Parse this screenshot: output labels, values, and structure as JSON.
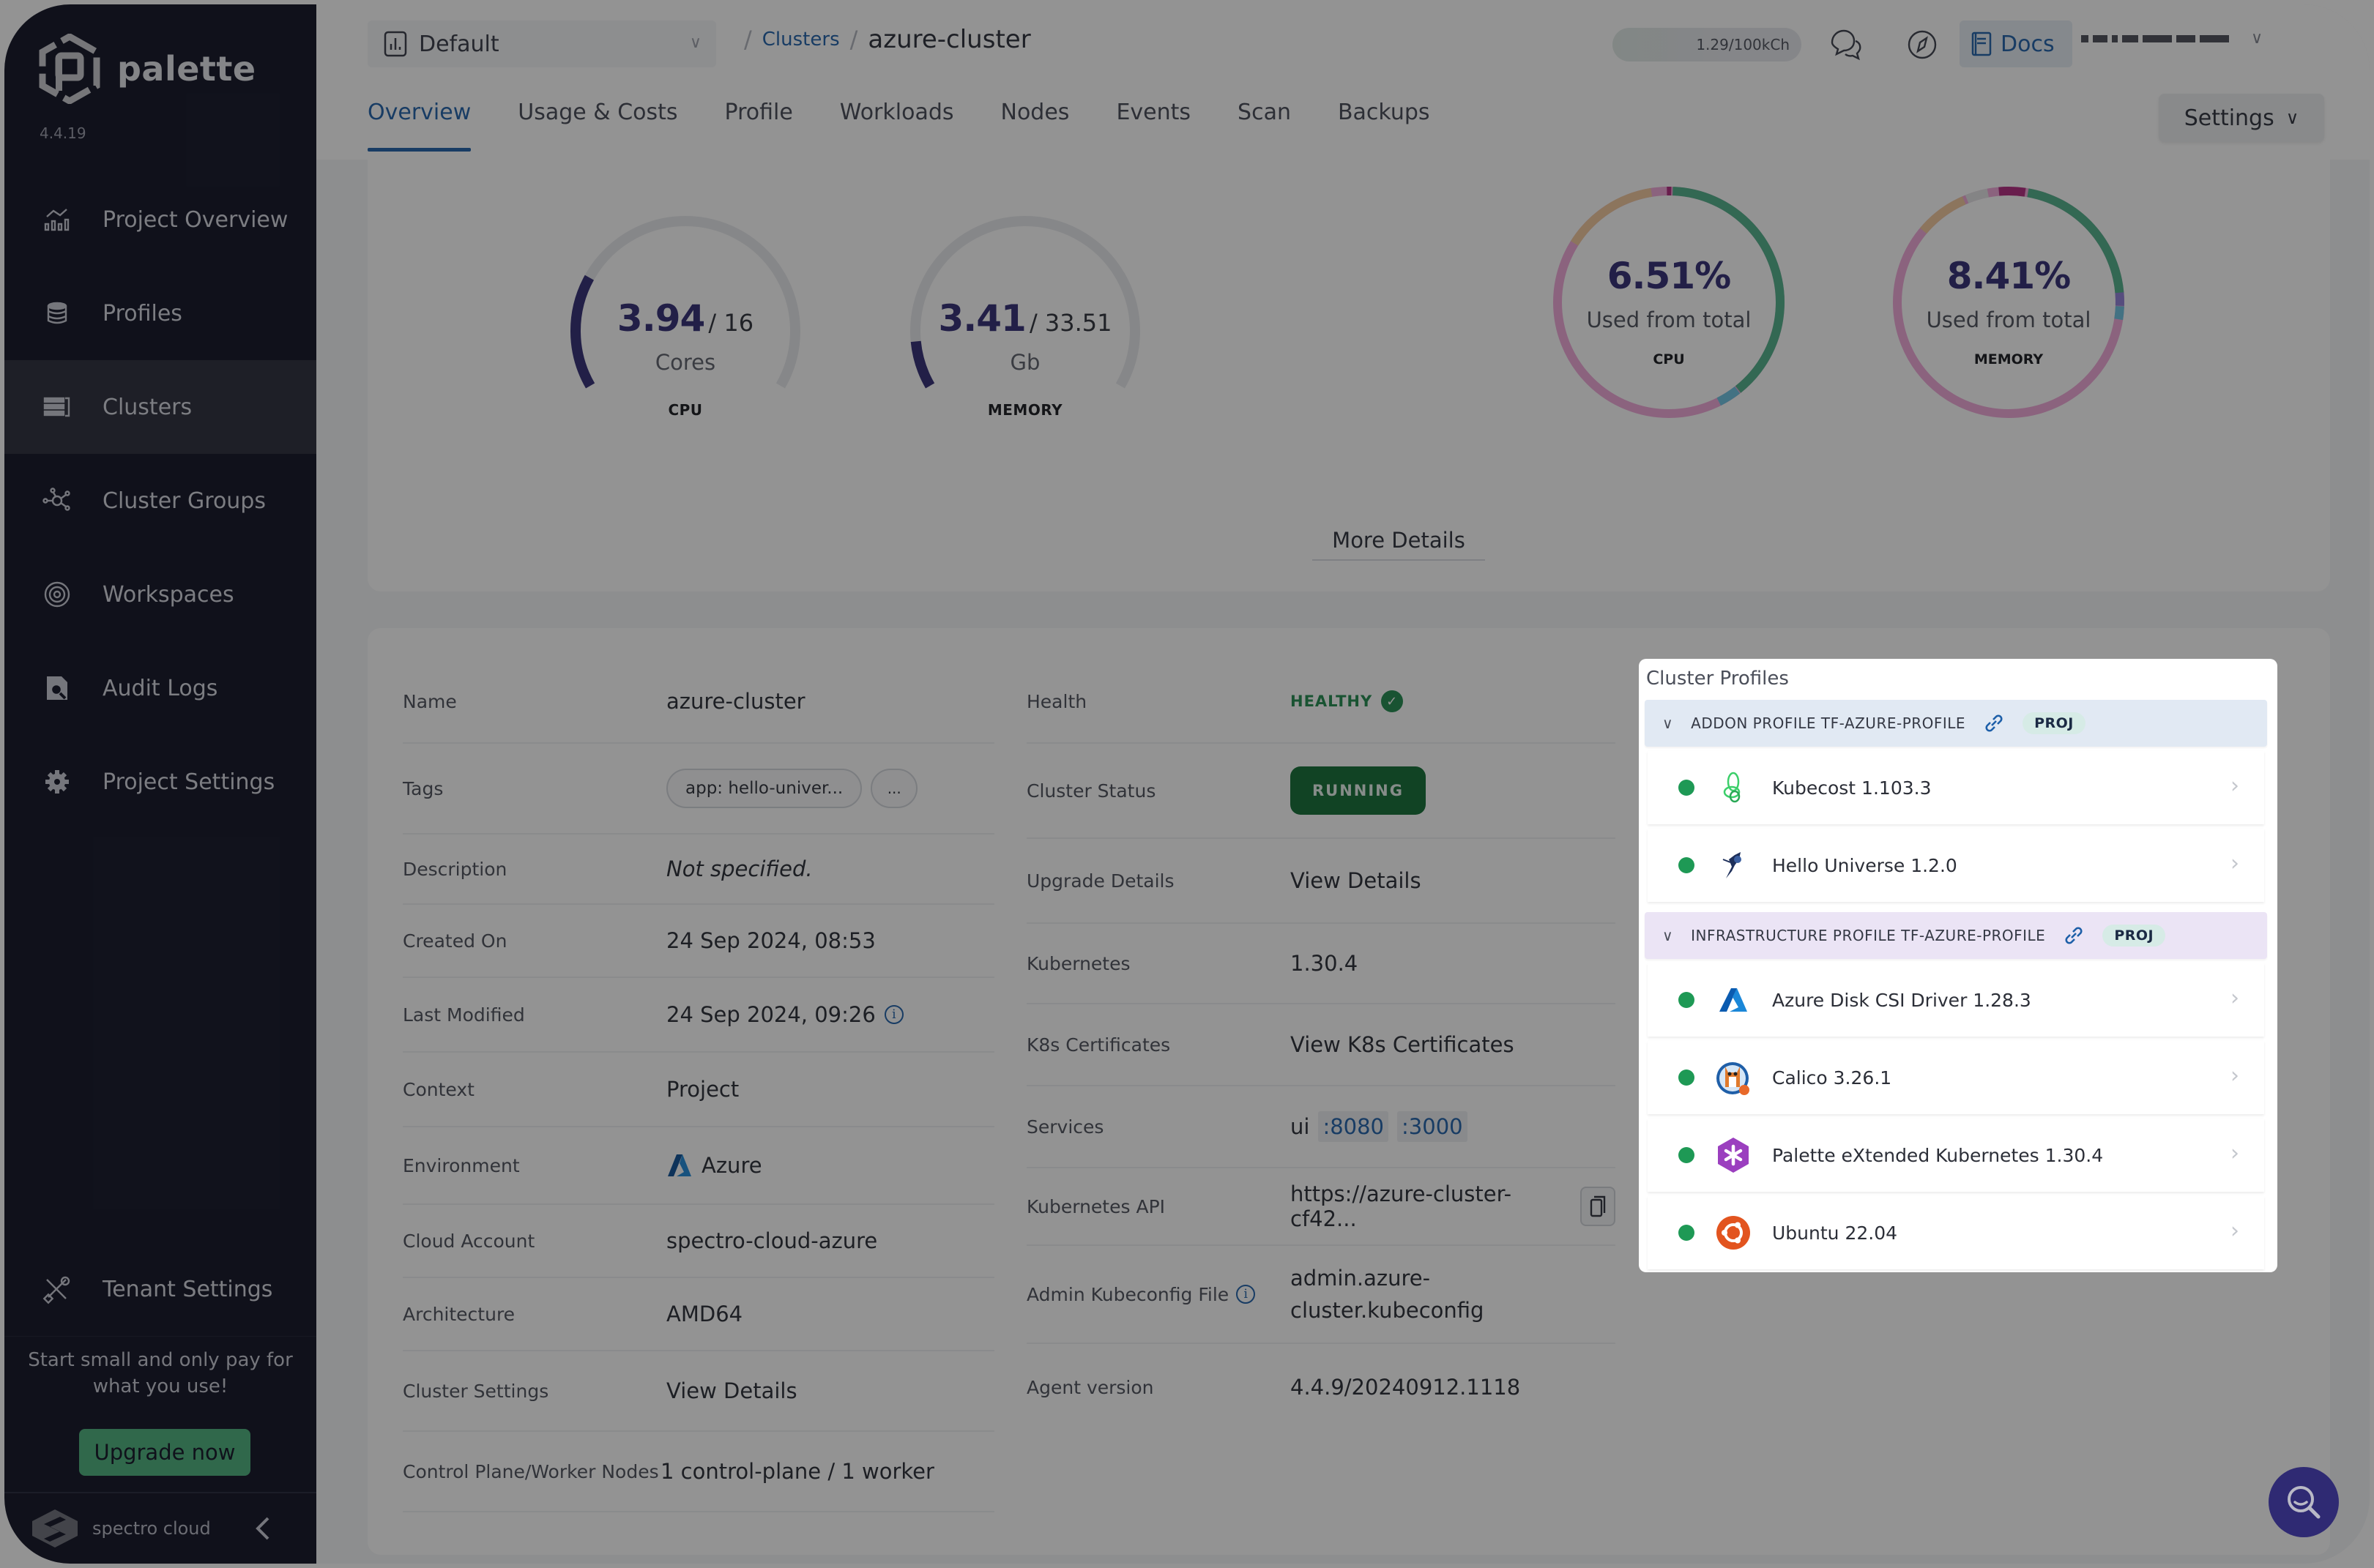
{
  "app": {
    "product_name": "palette",
    "version": "4.4.19"
  },
  "sidebar": {
    "items": [
      {
        "label": "Project Overview",
        "icon": "chart-line-bars-icon",
        "active": false
      },
      {
        "label": "Profiles",
        "icon": "database-stack-icon",
        "active": false
      },
      {
        "label": "Clusters",
        "icon": "server-rack-icon",
        "active": true
      },
      {
        "label": "Cluster Groups",
        "icon": "network-nodes-icon",
        "active": false
      },
      {
        "label": "Workspaces",
        "icon": "orbit-target-icon",
        "active": false
      },
      {
        "label": "Audit Logs",
        "icon": "document-search-icon",
        "active": false
      },
      {
        "label": "Project Settings",
        "icon": "gear-icon",
        "active": false
      }
    ],
    "tenant_settings": {
      "label": "Tenant Settings",
      "icon": "tools-icon"
    },
    "promo_text": "Start small and only pay for what you use!",
    "upgrade_label": "Upgrade now",
    "footer_brand": "spectro cloud"
  },
  "header": {
    "project": "Default",
    "breadcrumb": {
      "parent": "Clusters",
      "current": "azure-cluster"
    },
    "usage": "1.29/100kCh",
    "docs_label": "Docs",
    "user_name": "[redacted]",
    "tabs": [
      {
        "label": "Overview",
        "active": true
      },
      {
        "label": "Usage & Costs",
        "active": false
      },
      {
        "label": "Profile",
        "active": false
      },
      {
        "label": "Workloads",
        "active": false
      },
      {
        "label": "Nodes",
        "active": false
      },
      {
        "label": "Events",
        "active": false
      },
      {
        "label": "Scan",
        "active": false
      },
      {
        "label": "Backups",
        "active": false
      }
    ],
    "settings_label": "Settings"
  },
  "metrics": {
    "cpu_gauge": {
      "used": "3.94",
      "total": "/ 16",
      "unit": "Cores",
      "label": "CPU",
      "fraction": 0.246
    },
    "memory_gauge": {
      "used": "3.41",
      "total": "/ 33.51",
      "unit": "Gb",
      "label": "MEMORY",
      "fraction": 0.102
    },
    "cpu_donut": {
      "percent": "6.51%",
      "subtitle": "Used from total",
      "label": "CPU"
    },
    "memory_donut": {
      "percent": "8.41%",
      "subtitle": "Used from total",
      "label": "MEMORY"
    },
    "more_details_label": "More Details",
    "colors": {
      "accent": "#2f2a73",
      "track": "#e8e9ec"
    }
  },
  "details": {
    "left": [
      {
        "label": "Name",
        "value": "azure-cluster"
      },
      {
        "label": "Tags",
        "tag": "app: hello-univer...",
        "more": "..."
      },
      {
        "label": "Description",
        "value": "Not specified."
      },
      {
        "label": "Created On",
        "value": "24 Sep 2024, 08:53"
      },
      {
        "label": "Last Modified",
        "value": "24 Sep 2024, 09:26"
      },
      {
        "label": "Context",
        "value": "Project"
      },
      {
        "label": "Environment",
        "value": "Azure"
      },
      {
        "label": "Cloud Account",
        "value": "spectro-cloud-azure"
      },
      {
        "label": "Architecture",
        "value": "AMD64"
      },
      {
        "label": "Cluster Settings",
        "value": "View Details"
      },
      {
        "label": "Control Plane/Worker Nodes",
        "value": "1 control-plane / 1 worker"
      }
    ],
    "mid": [
      {
        "label": "Health",
        "value": "HEALTHY"
      },
      {
        "label": "Cluster Status",
        "value": "RUNNING"
      },
      {
        "label": "Upgrade Details",
        "value": "View Details"
      },
      {
        "label": "Kubernetes",
        "value": "1.30.4"
      },
      {
        "label": "K8s Certificates",
        "value": "View K8s Certificates"
      },
      {
        "label": "Services",
        "value": "ui",
        "ports": [
          ":8080",
          ":3000"
        ]
      },
      {
        "label": "Kubernetes API",
        "value": "https://azure-cluster-cf42..."
      },
      {
        "label": "Admin Kubeconfig File",
        "value_line1": "admin.azure-",
        "value_line2": "cluster.kubeconfig"
      },
      {
        "label": "Agent version",
        "value": "4.4.9/20240912.1118"
      }
    ],
    "colors": {
      "link": "#1d5fa8",
      "healthy": "#1f8a4c",
      "running_bg": "#0f6b33"
    }
  },
  "cluster_profiles": {
    "title": "Cluster Profiles",
    "groups": [
      {
        "title": "ADDON PROFILE TF-AZURE-PROFILE",
        "badge": "PROJ",
        "packs": [
          {
            "name": "Kubecost 1.103.3",
            "icon": "kubecost-icon",
            "status": "healthy"
          },
          {
            "name": "Hello Universe 1.2.0",
            "icon": "hello-universe-icon",
            "status": "healthy"
          }
        ]
      },
      {
        "title": "INFRASTRUCTURE PROFILE TF-AZURE-PROFILE",
        "badge": "PROJ",
        "packs": [
          {
            "name": "Azure Disk CSI Driver 1.28.3",
            "icon": "azure-icon",
            "status": "healthy"
          },
          {
            "name": "Calico 3.26.1",
            "icon": "calico-icon",
            "status": "healthy"
          },
          {
            "name": "Palette eXtended Kubernetes 1.30.4",
            "icon": "pxk-icon",
            "status": "healthy"
          },
          {
            "name": "Ubuntu 22.04",
            "icon": "ubuntu-icon",
            "status": "healthy"
          }
        ]
      }
    ]
  }
}
